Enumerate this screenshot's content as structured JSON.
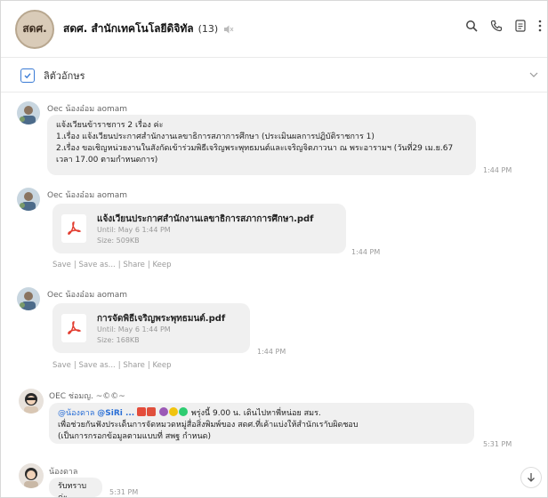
{
  "header": {
    "avatar_text": "สดศ.",
    "title": "สดศ. สำนักเทคโนโลยีดิจิทัล",
    "member_count": "(13)"
  },
  "notes": {
    "label": "ลิตัวอักษร"
  },
  "messages": [
    {
      "sender": "Oec น้องอ๋อม aomam",
      "lines": [
        "แจ้งเวียนข้าราชการ 2 เรื่อง ค่ะ",
        "1.เรื่อง แจ้งเวียนประกาศสำนักงานเลขาธิการสภาการศึกษา (ประเมินผลการปฏิบัติราชการ 1)",
        "2.เรื่อง ขอเชิญหน่วยงานในสังกัดเข้าร่วมพิธีเจริญพระพุทธมนต์และเจริญจิตภาวนา ณ พระอารามฯ (วันที่29 เม.ย.67",
        "เวลา 17.00 ตามกำหนดการ)"
      ],
      "time": "1:44 PM"
    },
    {
      "sender": "Oec น้องอ๋อม aomam",
      "file_name": "แจ้งเวียนประกาศสำนักงานเลขาธิการสภาการศึกษา.pdf",
      "until": "Until: May 6 1:44 PM",
      "size": "Size: 509KB",
      "time": "1:44 PM",
      "actions": [
        "Save",
        "Save as...",
        "Share",
        "Keep"
      ]
    },
    {
      "sender": "Oec น้องอ๋อม aomam",
      "file_name": "การจัดพิธีเจริญพระพุทธมนต์.pdf",
      "until": "Until: May 6 1:44 PM",
      "size": "Size: 168KB",
      "time": "1:44 PM",
      "actions": [
        "Save",
        "Save as...",
        "Share",
        "Keep"
      ]
    },
    {
      "sender": "OEC ช่อมญ. ~©©~",
      "mention1": "@น้องดาล",
      "mention2": "@SiRi ...",
      "line1_rest": "พรุ่งนี้ 9.00 น. เดินไปหาพี่หน่อย สมร.",
      "line2": "เพื่อช่วยกันฟังประเด็นการจัดหมวดหมู่สื่อสิ่งพิมพ์ของ สดศ.ที่เค้าแบ่งให้สำนักเราับผิดชอบ",
      "line3": "(เป็นการกรอกข้อมูลตามแบบที่ สพฐ กำหนด)",
      "time": "5:31 PM"
    },
    {
      "sender": "น้องดาล",
      "text": "รับทราบค่ะ",
      "time": "5:31 PM"
    }
  ],
  "colors": {
    "accent": "#3a7bd5",
    "bubble": "#f0f0f0",
    "pdf": "#e23b2e"
  }
}
